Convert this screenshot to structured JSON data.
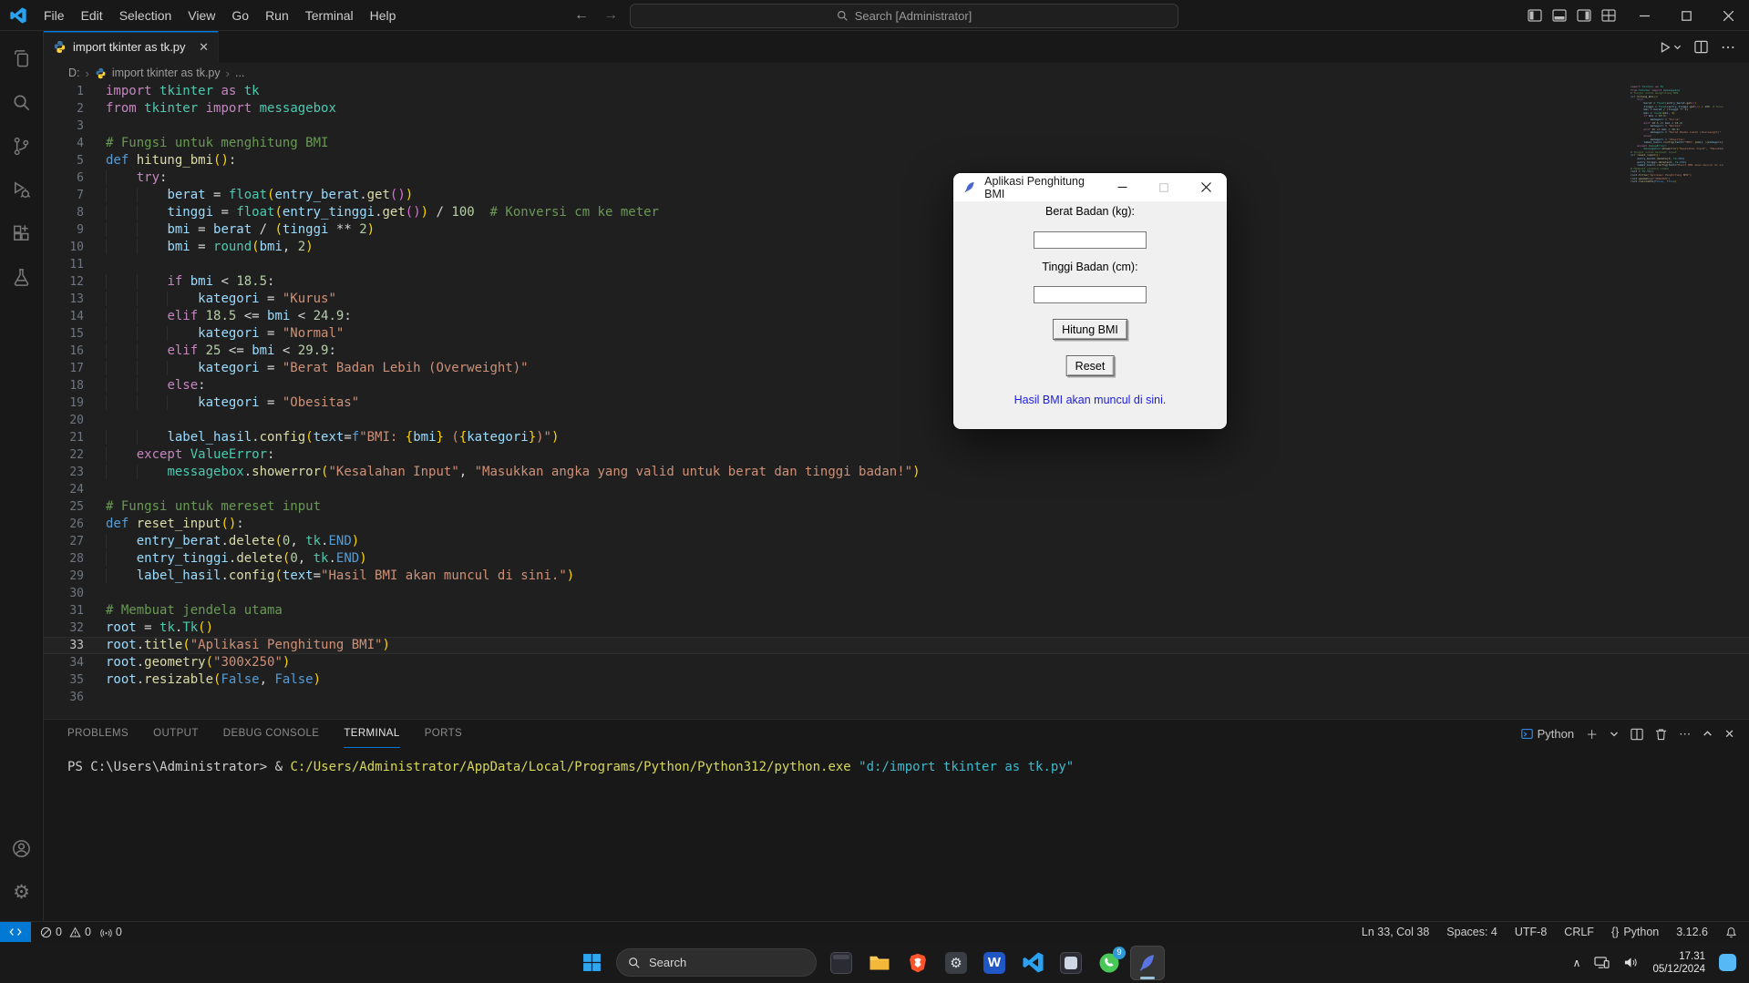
{
  "titlebar": {
    "menus": [
      "File",
      "Edit",
      "Selection",
      "View",
      "Go",
      "Run",
      "Terminal",
      "Help"
    ],
    "search_label": "Search [Administrator]"
  },
  "activity_bar": {
    "items": [
      "explorer",
      "search",
      "source-control",
      "run-and-debug",
      "extensions",
      "testing",
      "accounts",
      "settings"
    ]
  },
  "tab": {
    "label": "import tkinter as tk.py"
  },
  "breadcrumb": {
    "drive": "D:",
    "file": "import tkinter as tk.py",
    "more": "..."
  },
  "editor": {
    "current_line": 33,
    "lines": [
      {
        "n": 1,
        "tokens": [
          [
            "kw",
            "import "
          ],
          [
            "cls",
            "tkinter "
          ],
          [
            "kw",
            "as "
          ],
          [
            "cls",
            "tk"
          ]
        ]
      },
      {
        "n": 2,
        "tokens": [
          [
            "kw",
            "from "
          ],
          [
            "cls",
            "tkinter "
          ],
          [
            "kw",
            "import "
          ],
          [
            "cls",
            "messagebox"
          ]
        ]
      },
      {
        "n": 3,
        "tokens": []
      },
      {
        "n": 4,
        "tokens": [
          [
            "com",
            "# Fungsi untuk menghitung BMI"
          ]
        ]
      },
      {
        "n": 5,
        "tokens": [
          [
            "def",
            "def "
          ],
          [
            "fn",
            "hitung_bmi"
          ],
          [
            "p1",
            "()"
          ],
          [
            "op",
            ":"
          ]
        ]
      },
      {
        "n": 6,
        "tokens": [
          [
            "plain",
            "    "
          ],
          [
            "kw",
            "try"
          ],
          [
            "op",
            ":"
          ]
        ]
      },
      {
        "n": 7,
        "tokens": [
          [
            "plain",
            "        "
          ],
          [
            "var",
            "berat "
          ],
          [
            "op",
            "= "
          ],
          [
            "cls",
            "float"
          ],
          [
            "p1",
            "("
          ],
          [
            "var",
            "entry_berat"
          ],
          [
            "op",
            "."
          ],
          [
            "fn",
            "get"
          ],
          [
            "p2",
            "()"
          ],
          [
            "p1",
            ")"
          ]
        ]
      },
      {
        "n": 8,
        "tokens": [
          [
            "plain",
            "        "
          ],
          [
            "var",
            "tinggi "
          ],
          [
            "op",
            "= "
          ],
          [
            "cls",
            "float"
          ],
          [
            "p1",
            "("
          ],
          [
            "var",
            "entry_tinggi"
          ],
          [
            "op",
            "."
          ],
          [
            "fn",
            "get"
          ],
          [
            "p2",
            "()"
          ],
          [
            "p1",
            ")"
          ],
          [
            "op",
            " / "
          ],
          [
            "num",
            "100"
          ],
          [
            "com",
            "  # Konversi cm ke meter"
          ]
        ]
      },
      {
        "n": 9,
        "tokens": [
          [
            "plain",
            "        "
          ],
          [
            "var",
            "bmi "
          ],
          [
            "op",
            "= "
          ],
          [
            "var",
            "berat "
          ],
          [
            "op",
            "/ "
          ],
          [
            "p1",
            "("
          ],
          [
            "var",
            "tinggi "
          ],
          [
            "op",
            "** "
          ],
          [
            "num",
            "2"
          ],
          [
            "p1",
            ")"
          ]
        ]
      },
      {
        "n": 10,
        "tokens": [
          [
            "plain",
            "        "
          ],
          [
            "var",
            "bmi "
          ],
          [
            "op",
            "= "
          ],
          [
            "cls",
            "round"
          ],
          [
            "p1",
            "("
          ],
          [
            "var",
            "bmi"
          ],
          [
            "op",
            ", "
          ],
          [
            "num",
            "2"
          ],
          [
            "p1",
            ")"
          ]
        ]
      },
      {
        "n": 11,
        "tokens": []
      },
      {
        "n": 12,
        "tokens": [
          [
            "plain",
            "        "
          ],
          [
            "kw",
            "if "
          ],
          [
            "var",
            "bmi "
          ],
          [
            "op",
            "< "
          ],
          [
            "num",
            "18.5"
          ],
          [
            "op",
            ":"
          ]
        ]
      },
      {
        "n": 13,
        "tokens": [
          [
            "plain",
            "            "
          ],
          [
            "var",
            "kategori "
          ],
          [
            "op",
            "= "
          ],
          [
            "str",
            "\"Kurus\""
          ]
        ]
      },
      {
        "n": 14,
        "tokens": [
          [
            "plain",
            "        "
          ],
          [
            "kw",
            "elif "
          ],
          [
            "num",
            "18.5 "
          ],
          [
            "op",
            "<= "
          ],
          [
            "var",
            "bmi "
          ],
          [
            "op",
            "< "
          ],
          [
            "num",
            "24.9"
          ],
          [
            "op",
            ":"
          ]
        ]
      },
      {
        "n": 15,
        "tokens": [
          [
            "plain",
            "            "
          ],
          [
            "var",
            "kategori "
          ],
          [
            "op",
            "= "
          ],
          [
            "str",
            "\"Normal\""
          ]
        ]
      },
      {
        "n": 16,
        "tokens": [
          [
            "plain",
            "        "
          ],
          [
            "kw",
            "elif "
          ],
          [
            "num",
            "25 "
          ],
          [
            "op",
            "<= "
          ],
          [
            "var",
            "bmi "
          ],
          [
            "op",
            "< "
          ],
          [
            "num",
            "29.9"
          ],
          [
            "op",
            ":"
          ]
        ]
      },
      {
        "n": 17,
        "tokens": [
          [
            "plain",
            "            "
          ],
          [
            "var",
            "kategori "
          ],
          [
            "op",
            "= "
          ],
          [
            "str",
            "\"Berat Badan Lebih (Overweight)\""
          ]
        ]
      },
      {
        "n": 18,
        "tokens": [
          [
            "plain",
            "        "
          ],
          [
            "kw",
            "else"
          ],
          [
            "op",
            ":"
          ]
        ]
      },
      {
        "n": 19,
        "tokens": [
          [
            "plain",
            "            "
          ],
          [
            "var",
            "kategori "
          ],
          [
            "op",
            "= "
          ],
          [
            "str",
            "\"Obesitas\""
          ]
        ]
      },
      {
        "n": 20,
        "tokens": []
      },
      {
        "n": 21,
        "tokens": [
          [
            "plain",
            "        "
          ],
          [
            "var",
            "label_hasil"
          ],
          [
            "op",
            "."
          ],
          [
            "fn",
            "config"
          ],
          [
            "p1",
            "("
          ],
          [
            "var",
            "text"
          ],
          [
            "op",
            "="
          ],
          [
            "def",
            "f"
          ],
          [
            "str",
            "\"BMI: "
          ],
          [
            "p1",
            "{"
          ],
          [
            "var",
            "bmi"
          ],
          [
            "p1",
            "}"
          ],
          [
            "str",
            " ("
          ],
          [
            "p1",
            "{"
          ],
          [
            "var",
            "kategori"
          ],
          [
            "p1",
            "}"
          ],
          [
            "str",
            ")\""
          ],
          [
            "p1",
            ")"
          ]
        ]
      },
      {
        "n": 22,
        "tokens": [
          [
            "plain",
            "    "
          ],
          [
            "kw",
            "except "
          ],
          [
            "cls",
            "ValueError"
          ],
          [
            "op",
            ":"
          ]
        ]
      },
      {
        "n": 23,
        "tokens": [
          [
            "plain",
            "        "
          ],
          [
            "cls",
            "messagebox"
          ],
          [
            "op",
            "."
          ],
          [
            "fn",
            "showerror"
          ],
          [
            "p1",
            "("
          ],
          [
            "str",
            "\"Kesalahan Input\""
          ],
          [
            "op",
            ", "
          ],
          [
            "str",
            "\"Masukkan angka yang valid untuk berat dan tinggi badan!\""
          ],
          [
            "p1",
            ")"
          ]
        ]
      },
      {
        "n": 24,
        "tokens": []
      },
      {
        "n": 25,
        "tokens": [
          [
            "com",
            "# Fungsi untuk mereset input"
          ]
        ]
      },
      {
        "n": 26,
        "tokens": [
          [
            "def",
            "def "
          ],
          [
            "fn",
            "reset_input"
          ],
          [
            "p1",
            "()"
          ],
          [
            "op",
            ":"
          ]
        ]
      },
      {
        "n": 27,
        "tokens": [
          [
            "plain",
            "    "
          ],
          [
            "var",
            "entry_berat"
          ],
          [
            "op",
            "."
          ],
          [
            "fn",
            "delete"
          ],
          [
            "p1",
            "("
          ],
          [
            "num",
            "0"
          ],
          [
            "op",
            ", "
          ],
          [
            "cls",
            "tk"
          ],
          [
            "op",
            "."
          ],
          [
            "def",
            "END"
          ],
          [
            "p1",
            ")"
          ]
        ]
      },
      {
        "n": 28,
        "tokens": [
          [
            "plain",
            "    "
          ],
          [
            "var",
            "entry_tinggi"
          ],
          [
            "op",
            "."
          ],
          [
            "fn",
            "delete"
          ],
          [
            "p1",
            "("
          ],
          [
            "num",
            "0"
          ],
          [
            "op",
            ", "
          ],
          [
            "cls",
            "tk"
          ],
          [
            "op",
            "."
          ],
          [
            "def",
            "END"
          ],
          [
            "p1",
            ")"
          ]
        ]
      },
      {
        "n": 29,
        "tokens": [
          [
            "plain",
            "    "
          ],
          [
            "var",
            "label_hasil"
          ],
          [
            "op",
            "."
          ],
          [
            "fn",
            "config"
          ],
          [
            "p1",
            "("
          ],
          [
            "var",
            "text"
          ],
          [
            "op",
            "="
          ],
          [
            "str",
            "\"Hasil BMI akan muncul di sini.\""
          ],
          [
            "p1",
            ")"
          ]
        ]
      },
      {
        "n": 30,
        "tokens": []
      },
      {
        "n": 31,
        "tokens": [
          [
            "com",
            "# Membuat jendela utama"
          ]
        ]
      },
      {
        "n": 32,
        "tokens": [
          [
            "var",
            "root "
          ],
          [
            "op",
            "= "
          ],
          [
            "cls",
            "tk"
          ],
          [
            "op",
            "."
          ],
          [
            "cls",
            "Tk"
          ],
          [
            "p1",
            "()"
          ]
        ]
      },
      {
        "n": 33,
        "tokens": [
          [
            "var",
            "root"
          ],
          [
            "op",
            "."
          ],
          [
            "fn",
            "title"
          ],
          [
            "p1",
            "("
          ],
          [
            "str",
            "\"Aplikasi Penghitung BMI\""
          ],
          [
            "p1",
            ")"
          ]
        ]
      },
      {
        "n": 34,
        "tokens": [
          [
            "var",
            "root"
          ],
          [
            "op",
            "."
          ],
          [
            "fn",
            "geometry"
          ],
          [
            "p1",
            "("
          ],
          [
            "str",
            "\"300x250\""
          ],
          [
            "p1",
            ")"
          ]
        ]
      },
      {
        "n": 35,
        "tokens": [
          [
            "var",
            "root"
          ],
          [
            "op",
            "."
          ],
          [
            "fn",
            "resizable"
          ],
          [
            "p1",
            "("
          ],
          [
            "def",
            "False"
          ],
          [
            "op",
            ", "
          ],
          [
            "def",
            "False"
          ],
          [
            "p1",
            ")"
          ]
        ]
      },
      {
        "n": 36,
        "tokens": []
      }
    ]
  },
  "panel": {
    "tabs": [
      "PROBLEMS",
      "OUTPUT",
      "DEBUG CONSOLE",
      "TERMINAL",
      "PORTS"
    ],
    "active_tab": "TERMINAL",
    "shell_label": "Python",
    "terminal_line": [
      [
        "plain",
        "PS C:\\Users\\Administrator> "
      ],
      [
        "plain",
        "& "
      ],
      [
        "path",
        "C:/Users/Administrator/AppData/Local/Programs/Python/Python312/python.exe "
      ],
      [
        "arg",
        "\"d:/import tkinter as tk.py\""
      ]
    ]
  },
  "status_bar": {
    "errors": "0",
    "warnings": "0",
    "ports": "0",
    "right": [
      {
        "label": "Ln 33, Col 38"
      },
      {
        "label": "Spaces: 4"
      },
      {
        "label": "UTF-8"
      },
      {
        "label": "CRLF"
      },
      {
        "icon": "{}",
        "label": "Python"
      },
      {
        "label": "3.12.6"
      },
      {
        "icon": "bell",
        "label": ""
      }
    ]
  },
  "app_window": {
    "title": "Aplikasi Penghitung BMI",
    "weight_label": "Berat Badan (kg):",
    "height_label": "Tinggi Badan (cm):",
    "entry_weight_value": "",
    "entry_height_value": "",
    "calc_button": "Hitung BMI",
    "reset_button": "Reset",
    "result_text": "Hasil BMI akan muncul di sini."
  },
  "taskbar": {
    "search_label": "Search",
    "clock_time": "17.31",
    "clock_date": "05/12/2024",
    "apps": [
      {
        "name": "console-app"
      },
      {
        "name": "file-explorer"
      },
      {
        "name": "brave-browser"
      },
      {
        "name": "installer-app"
      },
      {
        "name": "ms-word"
      },
      {
        "name": "vs-code"
      },
      {
        "name": "photos-app"
      },
      {
        "name": "whatsapp",
        "badge": "9"
      },
      {
        "name": "python-tk-app",
        "active": true
      }
    ]
  },
  "colors": {
    "accent": "#0078d4",
    "editor_bg": "#1f1f1f",
    "chrome_bg": "#181818",
    "terminal_path_yellow": "#d7d75a",
    "terminal_string_cyan": "#3fb9cc",
    "result_blue": "#1d1de0",
    "python_blue": "#3a76a8",
    "python_yellow": "#ffd43b",
    "whatsapp_green": "#49c857",
    "brave_orange": "#fb542b",
    "word_blue": "#2156c5"
  }
}
